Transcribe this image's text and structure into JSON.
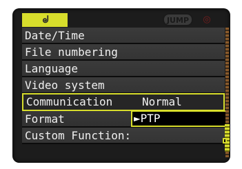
{
  "header": {
    "tab_icon": "tools-icon",
    "tab_glyph": "ᖙ",
    "jump_label": "JUMP",
    "red_tab_glyph": "◎"
  },
  "menu": {
    "items": [
      {
        "label": "Date/Time"
      },
      {
        "label": "File numbering"
      },
      {
        "label": "Language"
      },
      {
        "label": "Video system"
      },
      {
        "label": "Communication",
        "value": "Normal"
      },
      {
        "label": "Format"
      },
      {
        "label": "Custom Function:"
      }
    ]
  },
  "popup": {
    "selected_option": "►PTP"
  },
  "colors": {
    "accent": "#d8de2c",
    "row_bg": "#3b3b3b",
    "text": "#f0f0f0"
  }
}
